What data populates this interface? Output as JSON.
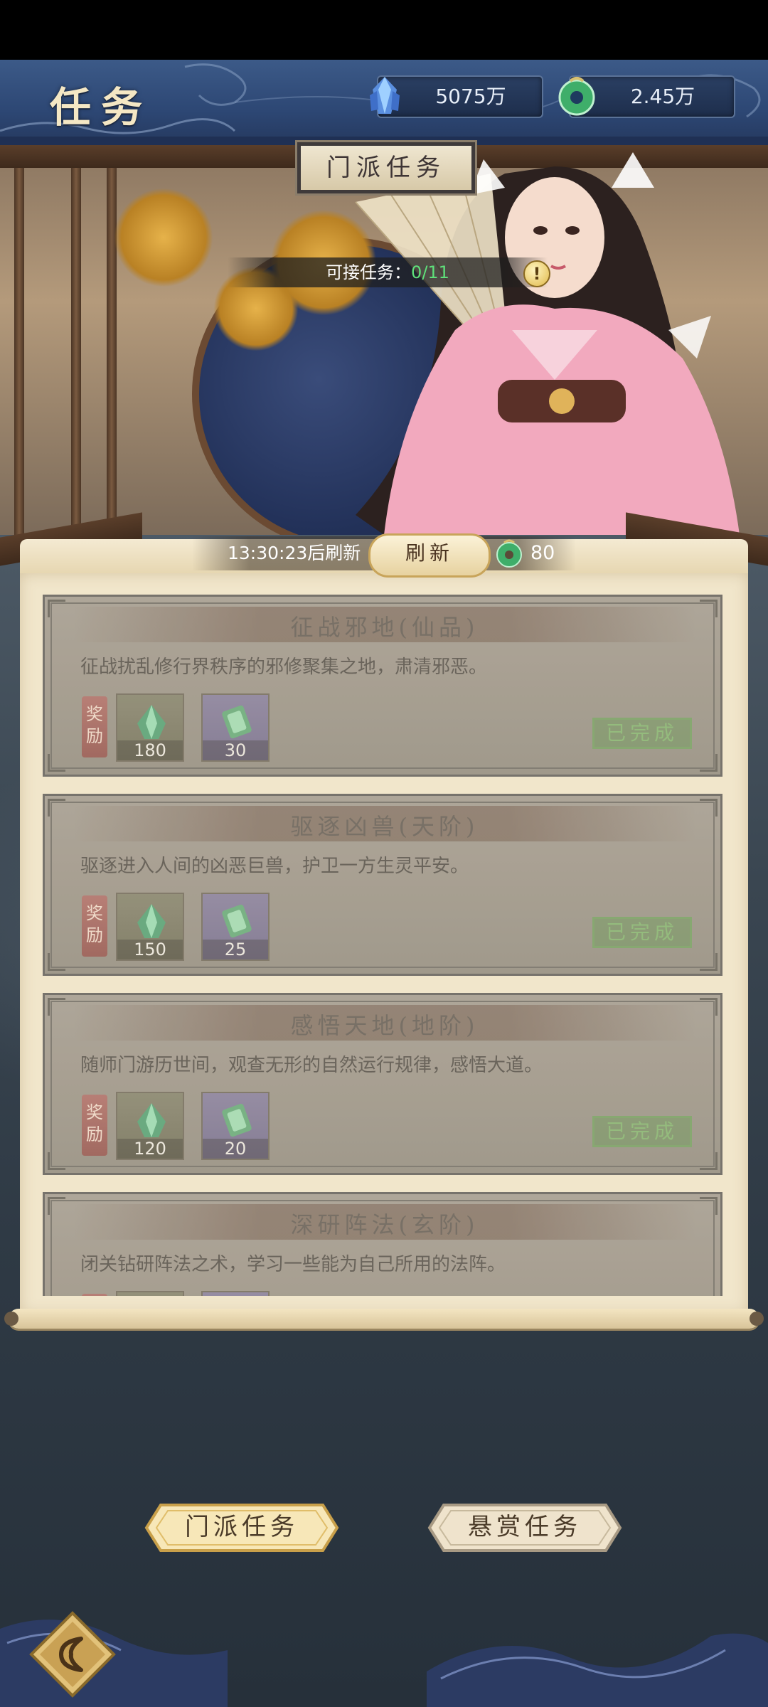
{
  "header": {
    "title": "任务",
    "currencies": [
      {
        "name": "crystal-icon",
        "value": "5075万"
      },
      {
        "name": "jade-coin-icon",
        "value": "2.45万"
      }
    ]
  },
  "hero": {
    "section_label": "门派任务",
    "available_label": "可接任务：",
    "available_count": "0/11",
    "info_glyph": "!"
  },
  "refresh": {
    "countdown": "13:30:23后刷新",
    "button_label": "刷新",
    "cost": "80"
  },
  "tasks": [
    {
      "title": "征战邪地(仙品)",
      "description": "征战扰乱修行界秩序的邪修聚集之地，肃清邪恶。",
      "reward_label": "奖励",
      "rewards": [
        {
          "icon": "green-spirit-stone-icon",
          "qty": "180"
        },
        {
          "icon": "purple-jade-icon",
          "qty": "30"
        }
      ],
      "status": "已完成"
    },
    {
      "title": "驱逐凶兽(天阶)",
      "description": "驱逐进入人间的凶恶巨兽，护卫一方生灵平安。",
      "reward_label": "奖励",
      "rewards": [
        {
          "icon": "green-spirit-stone-icon",
          "qty": "150"
        },
        {
          "icon": "purple-jade-icon",
          "qty": "25"
        }
      ],
      "status": "已完成"
    },
    {
      "title": "感悟天地(地阶)",
      "description": "随师门游历世间，观查无形的自然运行规律，感悟大道。",
      "reward_label": "奖励",
      "rewards": [
        {
          "icon": "green-spirit-stone-icon",
          "qty": "120"
        },
        {
          "icon": "purple-jade-icon",
          "qty": "20"
        }
      ],
      "status": "已完成"
    },
    {
      "title": "深研阵法(玄阶)",
      "description": "闭关钻研阵法之术，学习一些能为自己所用的法阵。",
      "reward_label": "奖励",
      "rewards": [
        {
          "icon": "green-spirit-stone-icon",
          "qty": ""
        },
        {
          "icon": "purple-jade-icon",
          "qty": ""
        }
      ],
      "status": ""
    }
  ],
  "tabs": [
    {
      "label": "门派任务",
      "active": true
    },
    {
      "label": "悬赏任务",
      "active": false
    }
  ],
  "colors": {
    "header_blue": "#2d4774",
    "parchment": "#f1e6cb",
    "done_green": "#8db877",
    "available_green": "#5fe07a"
  }
}
